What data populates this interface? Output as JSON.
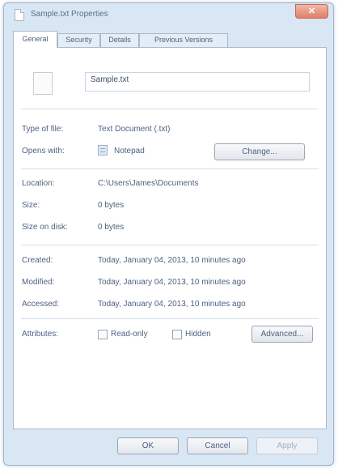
{
  "window": {
    "title": "Sample.txt Properties",
    "close_label": "✕"
  },
  "tabs": [
    "General",
    "Security",
    "Details",
    "Previous Versions"
  ],
  "general": {
    "file_name": "Sample.txt",
    "type_label": "Type of file:",
    "type_value": "Text Document (.txt)",
    "opens_label": "Opens with:",
    "opens_value": "Notepad",
    "change_label": "Change...",
    "location_label": "Location:",
    "location_value": "C:\\Users\\James\\Documents",
    "size_label": "Size:",
    "size_value": "0 bytes",
    "size_disk_label": "Size on disk:",
    "size_disk_value": "0 bytes",
    "created_label": "Created:",
    "created_value": "Today, January 04, 2013, 10 minutes ago",
    "modified_label": "Modified:",
    "modified_value": "Today, January 04, 2013, 10 minutes ago",
    "accessed_label": "Accessed:",
    "accessed_value": "Today, January 04, 2013, 10 minutes ago",
    "attributes_label": "Attributes:",
    "readonly_label": "Read-only",
    "readonly_checked": false,
    "hidden_label": "Hidden",
    "hidden_checked": false,
    "advanced_label": "Advanced..."
  },
  "footer": {
    "ok_label": "OK",
    "cancel_label": "Cancel",
    "apply_label": "Apply"
  },
  "icons": {
    "title": "file-icon",
    "file": "file-icon",
    "opens_with": "notepad-icon"
  }
}
